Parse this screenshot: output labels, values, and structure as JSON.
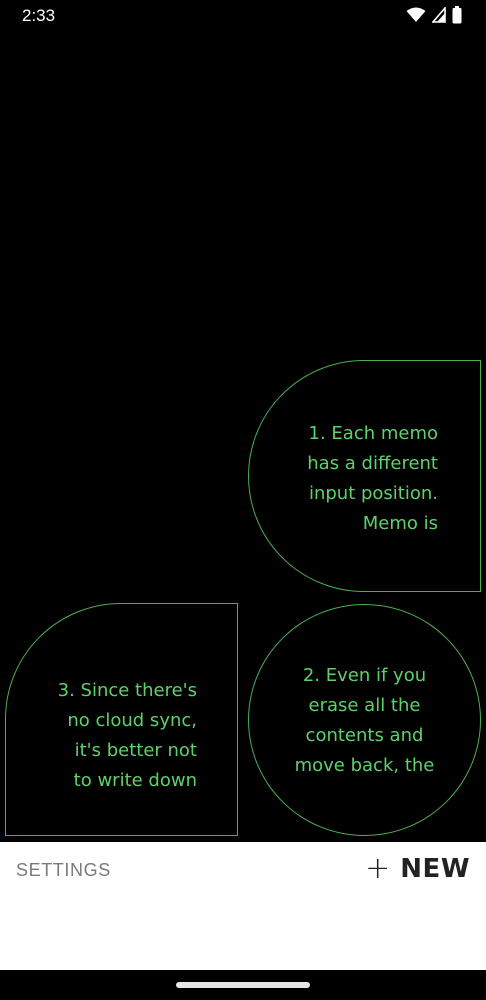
{
  "status_bar": {
    "time": "2:33",
    "icons": [
      "wifi-icon",
      "signal-icon",
      "battery-icon"
    ]
  },
  "memos": [
    {
      "id": 1,
      "text": "1. Each memo\nhas a different\ninput position.\nMemo is",
      "shape": "half-round-left"
    },
    {
      "id": 2,
      "text": "2. Even if you\nerase all the\ncontents and\nmove back, the",
      "shape": "circle"
    },
    {
      "id": 3,
      "text": "3. Since there's\nno cloud sync,\nit's better not\nto write down",
      "shape": "rounded-top-left"
    }
  ],
  "bottom_bar": {
    "settings_label": "SETTINGS",
    "new_plus": "+",
    "new_label": "NEW"
  },
  "colors": {
    "background": "#000000",
    "memo_stroke": "#4caf50",
    "memo_text": "#5fd16a",
    "panel": "#ffffff"
  }
}
